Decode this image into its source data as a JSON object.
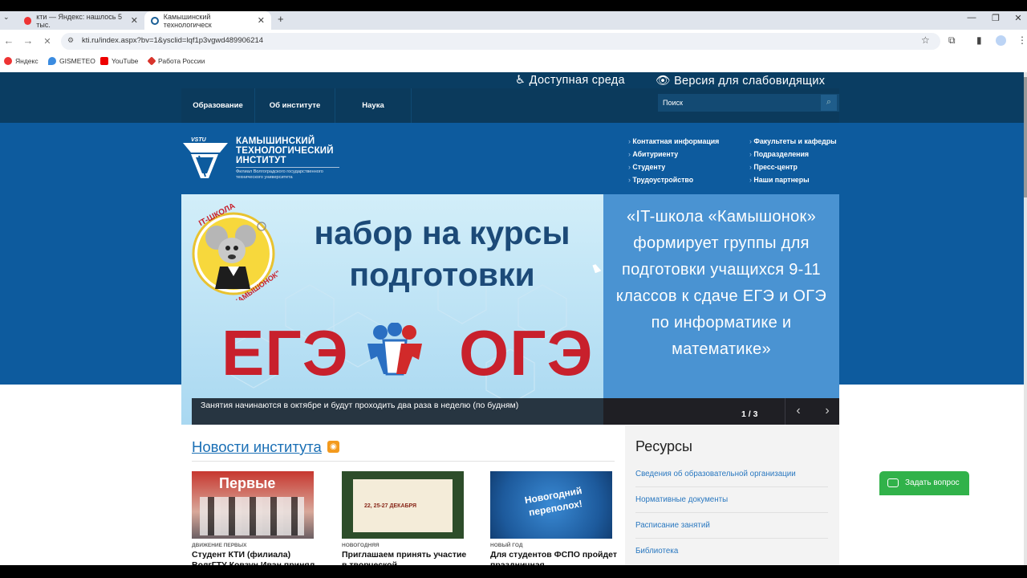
{
  "browser": {
    "tabs": [
      {
        "label": "кти — Яндекс: нашлось 5 тыс.",
        "active": false
      },
      {
        "label": "Камышинский технологическ",
        "active": true
      }
    ],
    "new_tab": "+",
    "url": "kti.ru/index.aspx?bv=1&ysclid=lqf1p3vgwd489906214",
    "bookmarks": [
      "Яндекс",
      "GISMETEO",
      "YouTube",
      "Работа России"
    ]
  },
  "site": {
    "menu": [
      "Образование",
      "Об институте",
      "Наука"
    ],
    "accessibility": {
      "accessible_env": "Доступная среда",
      "low_vision": "Версия для слабовидящих"
    },
    "search_placeholder": "Поиск",
    "logo": {
      "mark": "VSTU",
      "title_lines": [
        "КАМЫШИНСКИЙ",
        "ТЕХНОЛОГИЧЕСКИЙ",
        "ИНСТИТУТ"
      ],
      "subtitle": "Филиал Волгоградского государственного технического университета"
    },
    "quick_links_col1": [
      "Контактная информация",
      "Абитуриенту",
      "Студенту",
      "Трудоустройство"
    ],
    "quick_links_col2": [
      "Факультеты и кафедры",
      "Подразделения",
      "Пресс-центр",
      "Наши партнеры"
    ]
  },
  "banner": {
    "heading": "набор на курсы подготовки",
    "ege": "ЕГЭ",
    "oge": "ОГЭ",
    "mascot_label_top": "IT-ШКОЛА",
    "mascot_label_bottom": "\"КАМЫШОНОК\"",
    "quote": "«IT-школа «Камышонок» формирует группы для подготовки учащихся 9-11 классов к сдаче ЕГЭ и ОГЭ по информатике и математике»",
    "caption": "Занятия начинаются в октябре и будут проходить два раза в неделю (по будням)",
    "slide_counter": "1 / 3"
  },
  "news": {
    "heading": "Новости института",
    "items": [
      {
        "category": "движение первых",
        "title": "Студент КТИ (филиала) ВолгГТУ Ковзун Иван принял",
        "thumb_text": "Первые"
      },
      {
        "category": "новогодняя",
        "title": "Приглашаем принять участие в творческой",
        "thumb_text": "22, 25-27 ДЕКАБРЯ"
      },
      {
        "category": "новый год",
        "title": "Для студентов ФСПО пройдет праздничная",
        "thumb_text": "Новогодний переполох!"
      }
    ]
  },
  "resources": {
    "heading": "Ресурсы",
    "links": [
      "Сведения об образовательной организации",
      "Нормативные документы",
      "Расписание занятий",
      "Библиотека"
    ]
  },
  "ask_button": "Задать вопрос"
}
